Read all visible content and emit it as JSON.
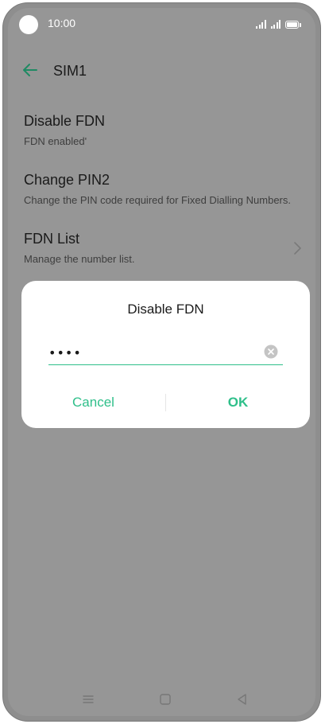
{
  "status_bar": {
    "time": "10:00"
  },
  "toolbar": {
    "title": "SIM1",
    "back_icon": "arrow-left-icon"
  },
  "list": {
    "items": [
      {
        "title": "Disable FDN",
        "subtitle": "FDN enabled'"
      },
      {
        "title": "Change PIN2",
        "subtitle": "Change the PIN code required for Fixed Dialling Numbers."
      },
      {
        "title": "FDN List",
        "subtitle": "Manage the number list."
      }
    ]
  },
  "dialog": {
    "title": "Disable FDN",
    "input_value": "••••",
    "cancel_label": "Cancel",
    "ok_label": "OK"
  },
  "nav_bar": {
    "icons": [
      "menu-icon",
      "home-icon",
      "back-triangle-icon"
    ]
  },
  "colors": {
    "accent": "#2fbf8a",
    "overlay_background": "#969696",
    "dialog_background": "#ffffff"
  }
}
